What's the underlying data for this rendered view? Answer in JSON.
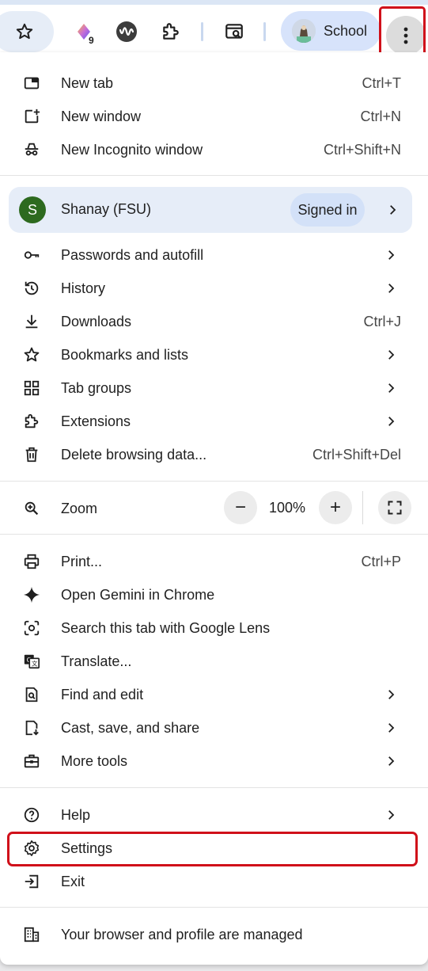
{
  "toolbar": {
    "extension_badge_count": "9",
    "profile_name": "School"
  },
  "menu": {
    "new_tab": {
      "label": "New tab",
      "shortcut": "Ctrl+T"
    },
    "new_window": {
      "label": "New window",
      "shortcut": "Ctrl+N"
    },
    "new_incognito": {
      "label": "New Incognito window",
      "shortcut": "Ctrl+Shift+N"
    },
    "account": {
      "avatar_letter": "S",
      "name": "Shanay (FSU)",
      "status": "Signed in",
      "avatar_color": "#2d6a1f"
    },
    "passwords": {
      "label": "Passwords and autofill"
    },
    "history": {
      "label": "History"
    },
    "downloads": {
      "label": "Downloads",
      "shortcut": "Ctrl+J"
    },
    "bookmarks": {
      "label": "Bookmarks and lists"
    },
    "tab_groups": {
      "label": "Tab groups"
    },
    "extensions": {
      "label": "Extensions"
    },
    "delete_data": {
      "label": "Delete browsing data...",
      "shortcut": "Ctrl+Shift+Del"
    },
    "zoom": {
      "label": "Zoom",
      "value": "100%",
      "minus": "−",
      "plus": "+"
    },
    "print": {
      "label": "Print...",
      "shortcut": "Ctrl+P"
    },
    "gemini": {
      "label": "Open Gemini in Chrome"
    },
    "lens": {
      "label": "Search this tab with Google Lens"
    },
    "translate": {
      "label": "Translate..."
    },
    "find_edit": {
      "label": "Find and edit"
    },
    "cast": {
      "label": "Cast, save, and share"
    },
    "more_tools": {
      "label": "More tools"
    },
    "help": {
      "label": "Help"
    },
    "settings": {
      "label": "Settings"
    },
    "exit": {
      "label": "Exit"
    },
    "managed": {
      "label": "Your browser and profile are managed"
    }
  },
  "colors": {
    "highlight": "#d0101a",
    "account_bg": "#e6edf8",
    "profile_pill": "#d7e3fb"
  }
}
